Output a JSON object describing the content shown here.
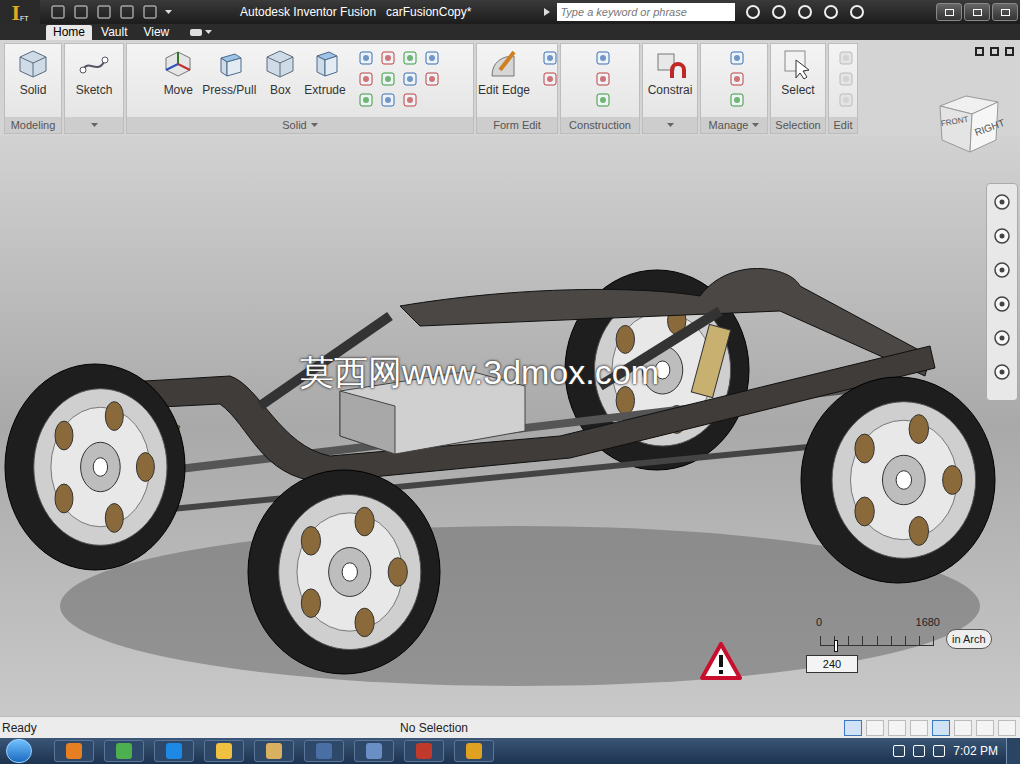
{
  "window": {
    "app": "Autodesk Inventor Fusion",
    "document": "carFusionCopy*",
    "logo": "I",
    "logo_sub": "FT"
  },
  "search": {
    "placeholder": "Type a keyword or phrase"
  },
  "tabs": [
    {
      "label": "Home",
      "selected": true
    },
    {
      "label": "Vault",
      "selected": false
    },
    {
      "label": "View",
      "selected": false
    }
  ],
  "ribbon": {
    "panels": [
      {
        "label": "Modeling",
        "dropdown": false,
        "buttons": [
          {
            "label": "Solid",
            "disabled": false
          }
        ]
      },
      {
        "label": "",
        "dropdown": true,
        "buttons": [
          {
            "label": "Sketch",
            "disabled": false
          }
        ]
      },
      {
        "label": "Solid",
        "dropdown": true,
        "buttons": [
          {
            "label": "Move",
            "disabled": false
          },
          {
            "label": "Press/Pull",
            "disabled": false
          },
          {
            "label": "Box",
            "disabled": false
          },
          {
            "label": "Extrude",
            "disabled": false
          }
        ]
      },
      {
        "label": "Form Edit",
        "dropdown": false,
        "buttons": [
          {
            "label": "Edit Edge",
            "disabled": false
          }
        ]
      },
      {
        "label": "Construction",
        "dropdown": false,
        "buttons": []
      },
      {
        "label": "",
        "dropdown": true,
        "buttons": [
          {
            "label": "Constrai",
            "disabled": false
          }
        ]
      },
      {
        "label": "Manage",
        "dropdown": true,
        "buttons": []
      },
      {
        "label": "Selection",
        "dropdown": false,
        "buttons": [
          {
            "label": "Select",
            "disabled": false
          }
        ]
      },
      {
        "label": "Edit",
        "dropdown": false,
        "buttons": []
      }
    ]
  },
  "viewcube": {
    "faces": [
      "FRONT",
      "RIGHT"
    ]
  },
  "watermark": "莫西网www.3dmox.com",
  "scale": {
    "min": "0",
    "max": "1680",
    "value": "240",
    "unit": "in Arch",
    "level": 0.143
  },
  "status_bar": {
    "left": "Ready",
    "center": "No Selection"
  },
  "taskbar": {
    "time": "7:02 PM"
  }
}
